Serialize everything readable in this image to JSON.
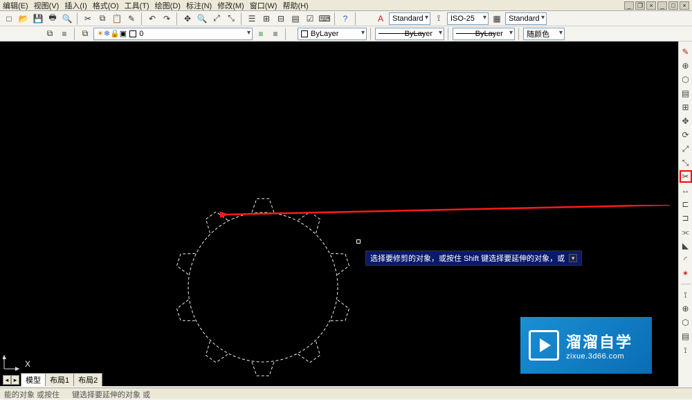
{
  "menu": {
    "m0": "编辑(E)",
    "m1": "视图(V)",
    "m2": "插入(I)",
    "m3": "格式(O)",
    "m4": "工具(T)",
    "m5": "绘图(D)",
    "m6": "标注(N)",
    "m7": "修改(M)",
    "m8": "窗口(W)",
    "m9": "帮助(H)"
  },
  "win": {
    "min": "_",
    "max": "□",
    "close": "×",
    "min2": "_",
    "max2": "❐",
    "close2": "×"
  },
  "style_row": {
    "text_style": "Standard",
    "dim_style": "ISO-25",
    "table_style": "Standard"
  },
  "layer_row": {
    "layer_state": "0",
    "bylayer": "ByLayer",
    "lt_bylayer": "ByLayer",
    "lw_bylayer": "ByLayer",
    "color": "随颜色"
  },
  "tooltip": {
    "text": "选择要修剪的对象，或按住 Shift 键选择要延伸的对象，或"
  },
  "tabs": {
    "t0": "模型",
    "t1": "布局1",
    "t2": "布局2"
  },
  "status": {
    "s0": "能的对象    或按住",
    "s1": "键选择要延伸的对象    或"
  },
  "ucs": {
    "x": "X"
  },
  "watermark": {
    "cn": "溜溜自学",
    "en": "zixue.3d66.com"
  },
  "icons": {
    "new": "□",
    "open": "📂",
    "save": "💾",
    "plot": "🖶",
    "preview": "🔍",
    "cut": "✂",
    "copy": "⧉",
    "paste": "📋",
    "match": "✎",
    "undo": "↶",
    "redo": "↷",
    "pan": "✥",
    "zoom": "🔍",
    "zoomw": "⤢",
    "zoome": "⤡",
    "props": "☰",
    "dcenter": "⊞",
    "tool": "⊟",
    "sheet": "▤",
    "markup": "☑",
    "calc": "⌨",
    "help": "?",
    "textstyle": "A",
    "dimstyle": "⟟",
    "tablestyle": "▦",
    "layers": "⧉",
    "layer1": "☀",
    "layer2": "❄",
    "layer3": "🔒",
    "layer4": "▣",
    "layermgr": "≡",
    "linecolor": "■",
    "rt_dist": "⟟",
    "rt_area": "⊕",
    "rt_region": "⬡",
    "rt_list": "▤",
    "rt_grid": "⊞",
    "rt_move": "✥",
    "rt_rotate": "⟳",
    "rt_scale": "⤢",
    "rt_stretch": "⤡",
    "rt_trim": "✂",
    "rt_extend": "↔",
    "rt_break": "⊏",
    "rt_break2": "⊐",
    "rt_join": "⫘",
    "rt_chamfer": "◣",
    "rt_fillet": "◜",
    "rt_explode": "✴",
    "rt_sep": " ",
    "rt_red": "✎"
  }
}
